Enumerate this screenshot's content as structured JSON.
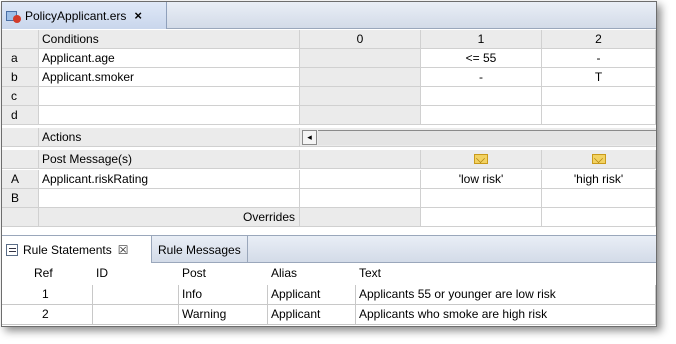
{
  "editor_tab": {
    "title": "PolicyApplicant.ers",
    "close": "×"
  },
  "grid": {
    "conditions_label": "Conditions",
    "rule_columns": [
      "0",
      "1",
      "2"
    ],
    "conditions": [
      {
        "letter": "a",
        "name": "Applicant.age",
        "r1": "<= 55",
        "r2": "-"
      },
      {
        "letter": "b",
        "name": "Applicant.smoker",
        "r1": "-",
        "r2": "T"
      },
      {
        "letter": "c",
        "name": "",
        "r1": "",
        "r2": ""
      },
      {
        "letter": "d",
        "name": "",
        "r1": "",
        "r2": ""
      }
    ],
    "actions_label": "Actions",
    "scroll_left": "◂",
    "post_message_label": "Post Message(s)",
    "actions": [
      {
        "letter": "A",
        "name": "Applicant.riskRating",
        "r1": "'low risk'",
        "r2": "'high risk'"
      },
      {
        "letter": "B",
        "name": "",
        "r1": "",
        "r2": ""
      }
    ],
    "overrides_label": "Overrides"
  },
  "panel": {
    "tabs": [
      {
        "label": "Rule Statements",
        "close": "☒"
      },
      {
        "label": "Rule Messages"
      }
    ],
    "headers": [
      "Ref",
      "ID",
      "Post",
      "Alias",
      "Text"
    ],
    "rows": [
      {
        "ref": "1",
        "id": "",
        "post": "Info",
        "alias": "Applicant",
        "text": "Applicants 55 or younger are low risk"
      },
      {
        "ref": "2",
        "id": "",
        "post": "Warning",
        "alias": "Applicant",
        "text": "Applicants who smoke are high risk"
      }
    ]
  }
}
